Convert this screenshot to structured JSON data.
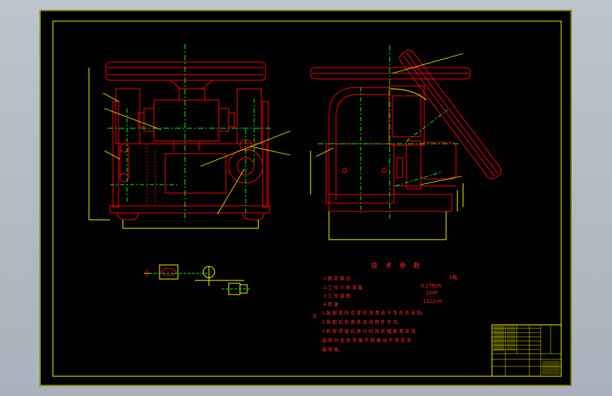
{
  "drawing": {
    "tech_title": "技 术 参 数",
    "specs": [
      {
        "label": "1.额 定 输 出",
        "value": "1吨"
      },
      {
        "label": "2.工 作 介 质 流 量",
        "value": "0.276t/h"
      },
      {
        "label": "3.工 作 温 度",
        "value": "100F"
      },
      {
        "label": "4.转 速",
        "value": "1322r/F"
      }
    ],
    "notes_prefix": "注",
    "notes": [
      "1.装 配 前,所 有 零 件 须 清 洗 干 净 并 去 毛 刺。",
      "2.装 配 后 检 查 各 运 动 部 件 灵 活。",
      "3.机 架 焊 接 后 进 行 时 效 处 理,表 面 涂 漆,",
      "  运 转 时 无 异 常 噪 声 和 振 动,不 得 有 渗",
      "  漏 现 象。"
    ]
  },
  "colors": {
    "background": "#000000",
    "frame": "#ffff00",
    "outline": "#ff0000",
    "centerline": "#00ff00",
    "leader": "#ffff00"
  }
}
